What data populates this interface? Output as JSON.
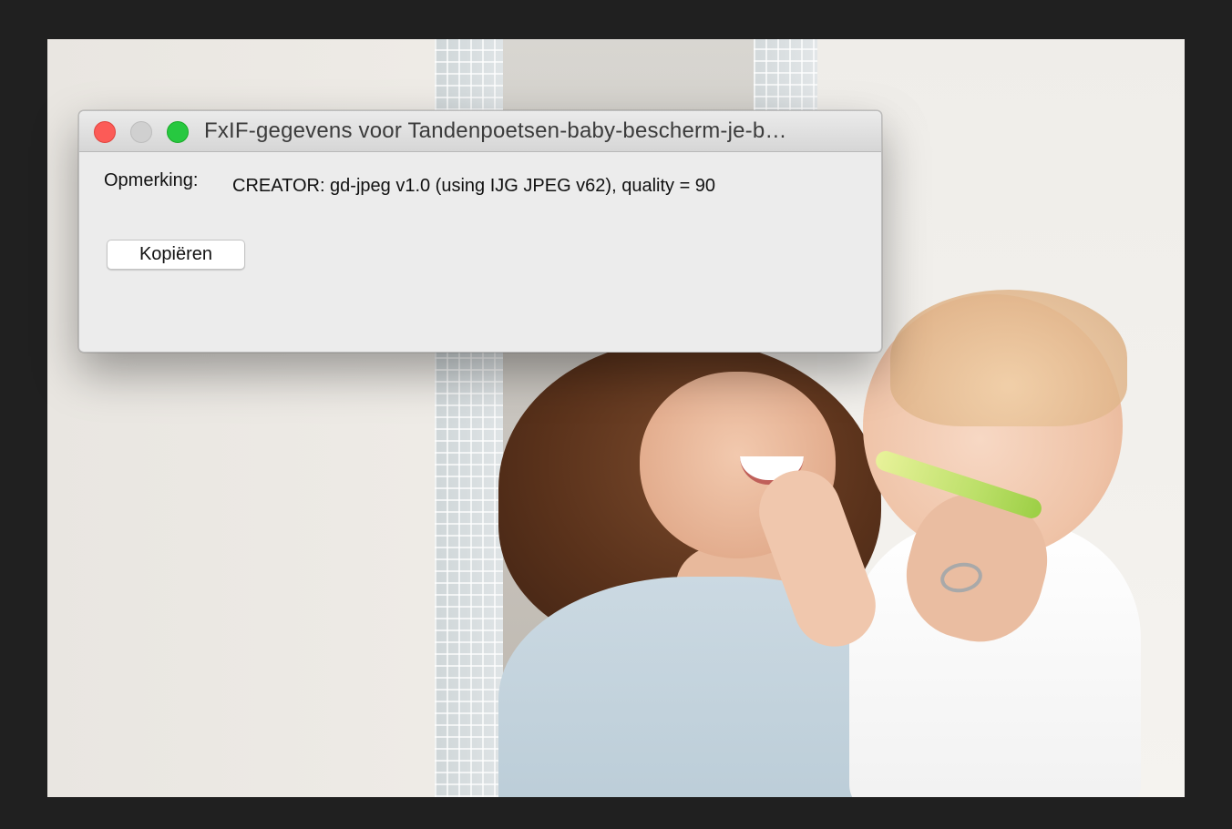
{
  "window": {
    "title": "FxIF-gegevens voor Tandenpoetsen-baby-bescherm-je-b…",
    "controls": {
      "close": "close-button",
      "minimize": "minimize-button",
      "zoom": "zoom-button"
    }
  },
  "exif": {
    "label": "Opmerking:",
    "value": "CREATOR: gd-jpeg v1.0 (using IJG JPEG v62), quality = 90"
  },
  "actions": {
    "copy_label": "Kopiëren"
  },
  "colors": {
    "close": "#fc5b57",
    "minimize": "#d0d0d0",
    "zoom": "#27c840",
    "window_bg": "#ececec",
    "backdrop": "#202020"
  }
}
